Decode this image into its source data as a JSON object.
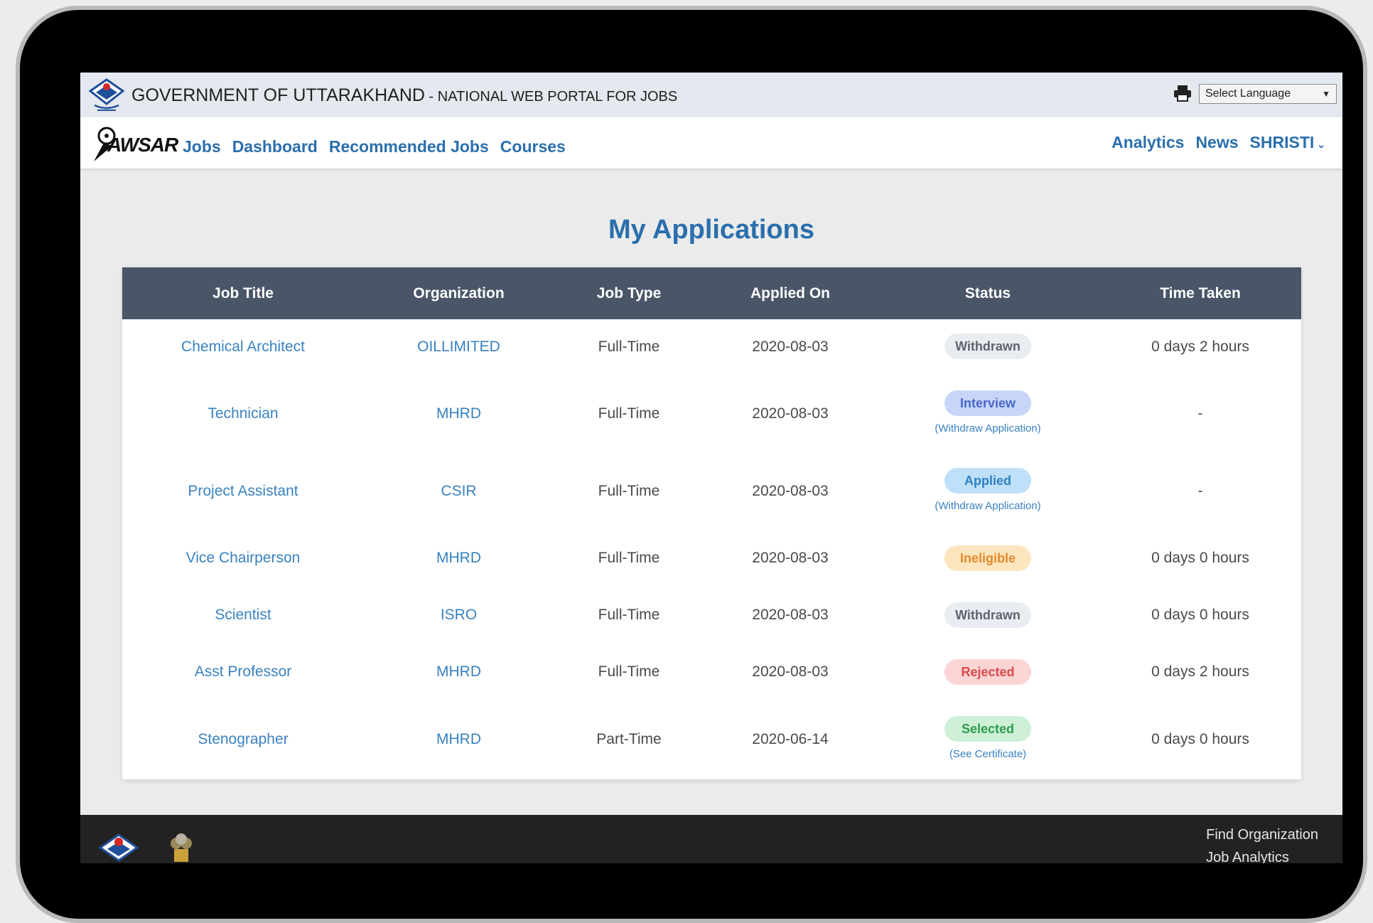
{
  "gov": {
    "title": "GOVERNMENT OF UTTARAKHAND",
    "subtitle": " - NATIONAL WEB PORTAL FOR JOBS",
    "language_select": "Select Language"
  },
  "nav": {
    "logo_text": "AWSAR",
    "left": [
      "Jobs",
      "Dashboard",
      "Recommended Jobs",
      "Courses"
    ],
    "right": [
      "Analytics",
      "News"
    ],
    "user": "SHRISTI"
  },
  "page": {
    "title": "My Applications"
  },
  "table": {
    "headers": [
      "Job Title",
      "Organization",
      "Job Type",
      "Applied On",
      "Status",
      "Time Taken"
    ],
    "rows": [
      {
        "title": "Chemical Architect",
        "org": "OILLIMITED",
        "type": "Full-Time",
        "date": "2020-08-03",
        "status": "Withdrawn",
        "note": "",
        "time": "0 days 2 hours"
      },
      {
        "title": "Technician",
        "org": "MHRD",
        "type": "Full-Time",
        "date": "2020-08-03",
        "status": "Interview",
        "note": "(Withdraw Application)",
        "time": "-"
      },
      {
        "title": "Project Assistant",
        "org": "CSIR",
        "type": "Full-Time",
        "date": "2020-08-03",
        "status": "Applied",
        "note": "(Withdraw Application)",
        "time": "-"
      },
      {
        "title": "Vice Chairperson",
        "org": "MHRD",
        "type": "Full-Time",
        "date": "2020-08-03",
        "status": "Ineligible",
        "note": "",
        "time": "0 days 0 hours"
      },
      {
        "title": "Scientist",
        "org": "ISRO",
        "type": "Full-Time",
        "date": "2020-08-03",
        "status": "Withdrawn",
        "note": "",
        "time": "0 days 0 hours"
      },
      {
        "title": "Asst Professor",
        "org": "MHRD",
        "type": "Full-Time",
        "date": "2020-08-03",
        "status": "Rejected",
        "note": "",
        "time": "0 days 2 hours"
      },
      {
        "title": "Stenographer",
        "org": "MHRD",
        "type": "Part-Time",
        "date": "2020-06-14",
        "status": "Selected",
        "note": "(See Certificate)",
        "time": "0 days 0 hours"
      }
    ]
  },
  "footer": {
    "links": [
      "Find Organization",
      "Job Analytics"
    ]
  },
  "colors": {
    "accent": "#2a6fad",
    "header_bg": "#4a5568",
    "footer_bg": "#222222"
  },
  "icons": {
    "gov_emblem": "uttarakhand-emblem-icon",
    "print": "printer-icon",
    "national_emblem": "national-emblem-icon"
  }
}
